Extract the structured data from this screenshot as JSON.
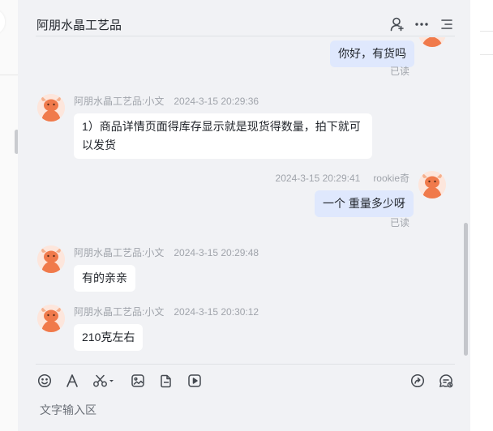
{
  "header": {
    "title": "阿朋水晶工艺品"
  },
  "icons": {
    "header": [
      "add-user-icon",
      "more-icon",
      "list-icon"
    ],
    "toolbar": [
      "emoji-icon",
      "font-icon",
      "scissors-icon",
      "image-icon",
      "file-icon",
      "video-icon",
      "share-icon",
      "chat-settings-icon"
    ]
  },
  "messages": [
    {
      "direction": "out",
      "text": "你好，有货吗",
      "read": "已读"
    },
    {
      "direction": "in",
      "sender": "阿朋水晶工艺品:小文",
      "time": "2024-3-15 20:29:36",
      "text": "1）商品详情页面得库存显示就是现货得数量，拍下就可以发货"
    },
    {
      "direction": "out",
      "sender": "rookie奇",
      "time": "2024-3-15 20:29:41",
      "text": "一个 重量多少呀",
      "read": "已读"
    },
    {
      "direction": "in",
      "sender": "阿朋水晶工艺品:小文",
      "time": "2024-3-15 20:29:48",
      "text": "有的亲亲"
    },
    {
      "direction": "in",
      "sender": "阿朋水晶工艺品:小文",
      "time": "2024-3-15 20:30:12",
      "text": "210克左右"
    }
  ],
  "input": {
    "placeholder": "文字输入区"
  },
  "colors": {
    "panel_bg": "#f1f2f5",
    "outgoing_bubble": "#dfe8fd",
    "incoming_bubble": "#ffffff",
    "avatar_accent": "#f07a4b"
  }
}
